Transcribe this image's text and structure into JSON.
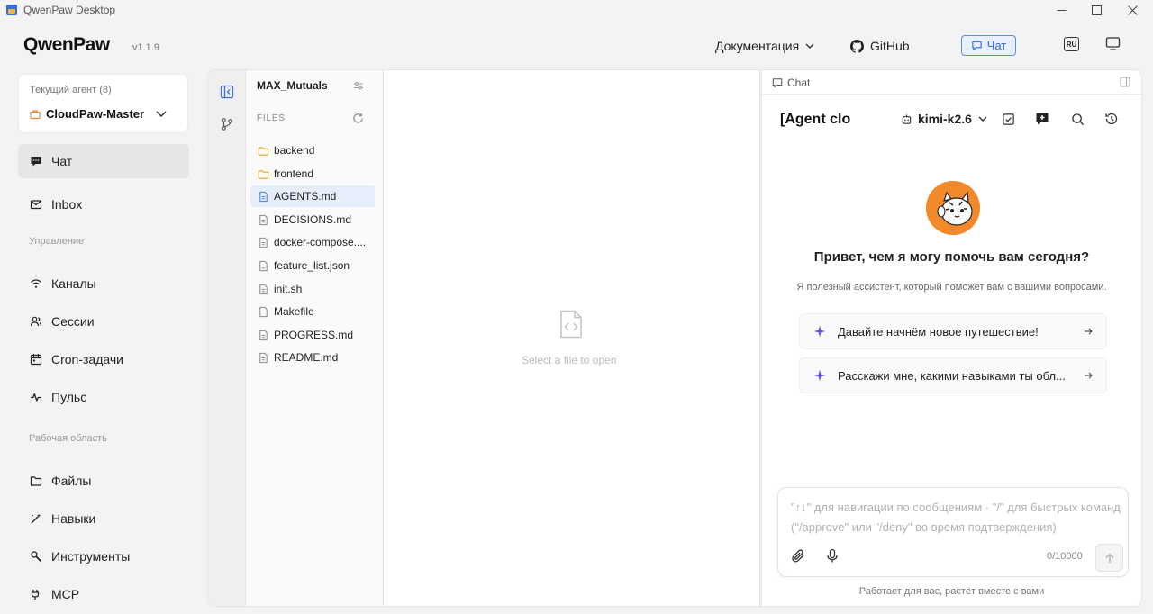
{
  "window": {
    "title": "QwenPaw Desktop"
  },
  "header": {
    "logo": "QwenPaw",
    "version": "v1.1.9",
    "docs_label": "Документация",
    "github_label": "GitHub",
    "chat_button_label": "Чат",
    "language_badge": "RU"
  },
  "sidebar": {
    "agent_label": "Текущий агент (8)",
    "agent_name": "CloudPaw-Master",
    "items": [
      {
        "label": "Чат",
        "icon": "chat-bubble-icon"
      },
      {
        "label": "Inbox",
        "icon": "mail-icon"
      }
    ],
    "section_manage": "Управление",
    "manage_items": [
      {
        "label": "Каналы",
        "icon": "wifi-icon"
      },
      {
        "label": "Сессии",
        "icon": "users-icon"
      },
      {
        "label": "Cron-задачи",
        "icon": "calendar-icon"
      },
      {
        "label": "Пульс",
        "icon": "pulse-icon"
      }
    ],
    "section_workspace": "Рабочая область",
    "workspace_items": [
      {
        "label": "Файлы",
        "icon": "folder-icon"
      },
      {
        "label": "Навыки",
        "icon": "magic-wand-icon"
      },
      {
        "label": "Инструменты",
        "icon": "wrench-icon"
      },
      {
        "label": "MCP",
        "icon": "plug-icon"
      }
    ]
  },
  "files": {
    "project_name": "MAX_Mutuals",
    "section_label": "FILES",
    "entries": [
      {
        "name": "backend",
        "type": "folder"
      },
      {
        "name": "frontend",
        "type": "folder"
      },
      {
        "name": "AGENTS.md",
        "type": "file",
        "selected": true
      },
      {
        "name": "DECISIONS.md",
        "type": "file"
      },
      {
        "name": "docker-compose....",
        "type": "file"
      },
      {
        "name": "feature_list.json",
        "type": "file"
      },
      {
        "name": "init.sh",
        "type": "file"
      },
      {
        "name": "Makefile",
        "type": "file"
      },
      {
        "name": "PROGRESS.md",
        "type": "file"
      },
      {
        "name": "README.md",
        "type": "file"
      }
    ]
  },
  "editor": {
    "empty_text": "Select a file to open"
  },
  "chat": {
    "tab_label": "Chat",
    "agent_title": "[Agent clo",
    "model": "kimi-k2.6",
    "greeting": "Привет, чем я могу помочь вам сегодня?",
    "subtitle": "Я полезный ассистент, который поможет вам с вашими вопросами.",
    "suggestions": [
      "Давайте начнём новое путешествие!",
      "Расскажи мне, какими навыками ты обл..."
    ],
    "input_placeholder": "\"↑↓\" для навигации по сообщениям · \"/\" для быстрых команд (\"/approve\" или \"/deny\" во время подтверждения)",
    "char_count": "0/10000",
    "footer": "Работает для вас, растёт вместе с вами"
  },
  "colors": {
    "accent": "#2e6ad6",
    "avatar_bg": "#f28a2c",
    "sparkle": "#6b4fd8"
  }
}
